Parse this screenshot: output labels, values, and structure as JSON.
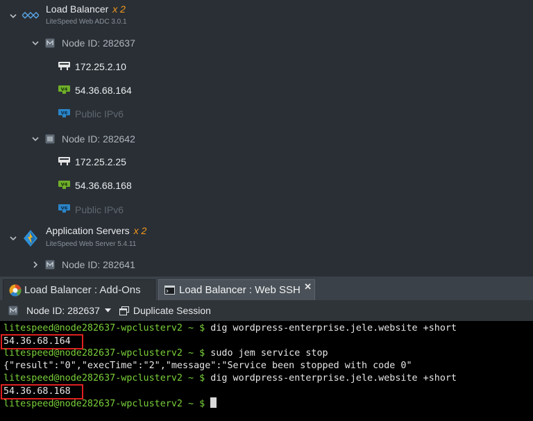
{
  "tree": {
    "load_balancer": {
      "title": "Load Balancer",
      "multiplier": "x 2",
      "subtitle": "LiteSpeed Web ADC 3.0.1",
      "nodes": [
        {
          "label": "Node ID: 282637",
          "ips": [
            {
              "badge": "lan",
              "value": "172.25.2.10",
              "dim": false
            },
            {
              "badge": "v4",
              "value": "54.36.68.164",
              "dim": false
            },
            {
              "badge": "v6",
              "value": "Public IPv6",
              "dim": true
            }
          ]
        },
        {
          "label": "Node ID: 282642",
          "ips": [
            {
              "badge": "lan",
              "value": "172.25.2.25",
              "dim": false
            },
            {
              "badge": "v4",
              "value": "54.36.68.168",
              "dim": false
            },
            {
              "badge": "v6",
              "value": "Public IPv6",
              "dim": true
            }
          ]
        }
      ]
    },
    "app_servers": {
      "title": "Application Servers",
      "multiplier": "x 2",
      "subtitle": "LiteSpeed Web Server 5.4.11",
      "nodes": [
        {
          "label": "Node ID: 282641"
        }
      ]
    }
  },
  "tabs": [
    {
      "label": "Load Balancer : Add-Ons",
      "active": false
    },
    {
      "label": "Load Balancer : Web SSH",
      "active": true
    }
  ],
  "toolbar": {
    "node_select": "Node ID: 282637",
    "duplicate_label": "Duplicate Session"
  },
  "terminal": {
    "lines": [
      {
        "prompt": "litespeed@node282637-wpclusterv2 ~ $",
        "command": " dig wordpress-enterprise.jele.website +short"
      },
      {
        "output": "54.36.68.164",
        "highlighted": true
      },
      {
        "prompt": "litespeed@node282637-wpclusterv2 ~ $",
        "command": " sudo jem service stop"
      },
      {
        "output": "{\"result\":\"0\",\"execTime\":\"2\",\"message\":\"Service been stopped with code 0\""
      },
      {
        "prompt": "litespeed@node282637-wpclusterv2 ~ $",
        "command": " dig wordpress-enterprise.jele.website +short"
      },
      {
        "output": "54.36.68.168",
        "highlighted": true
      },
      {
        "prompt": "litespeed@node282637-wpclusterv2 ~ $",
        "command": " "
      }
    ]
  },
  "icons": {
    "badge_v4": "#6fae2a",
    "badge_v6": "#2b84c6",
    "highlight": "#e02020"
  }
}
